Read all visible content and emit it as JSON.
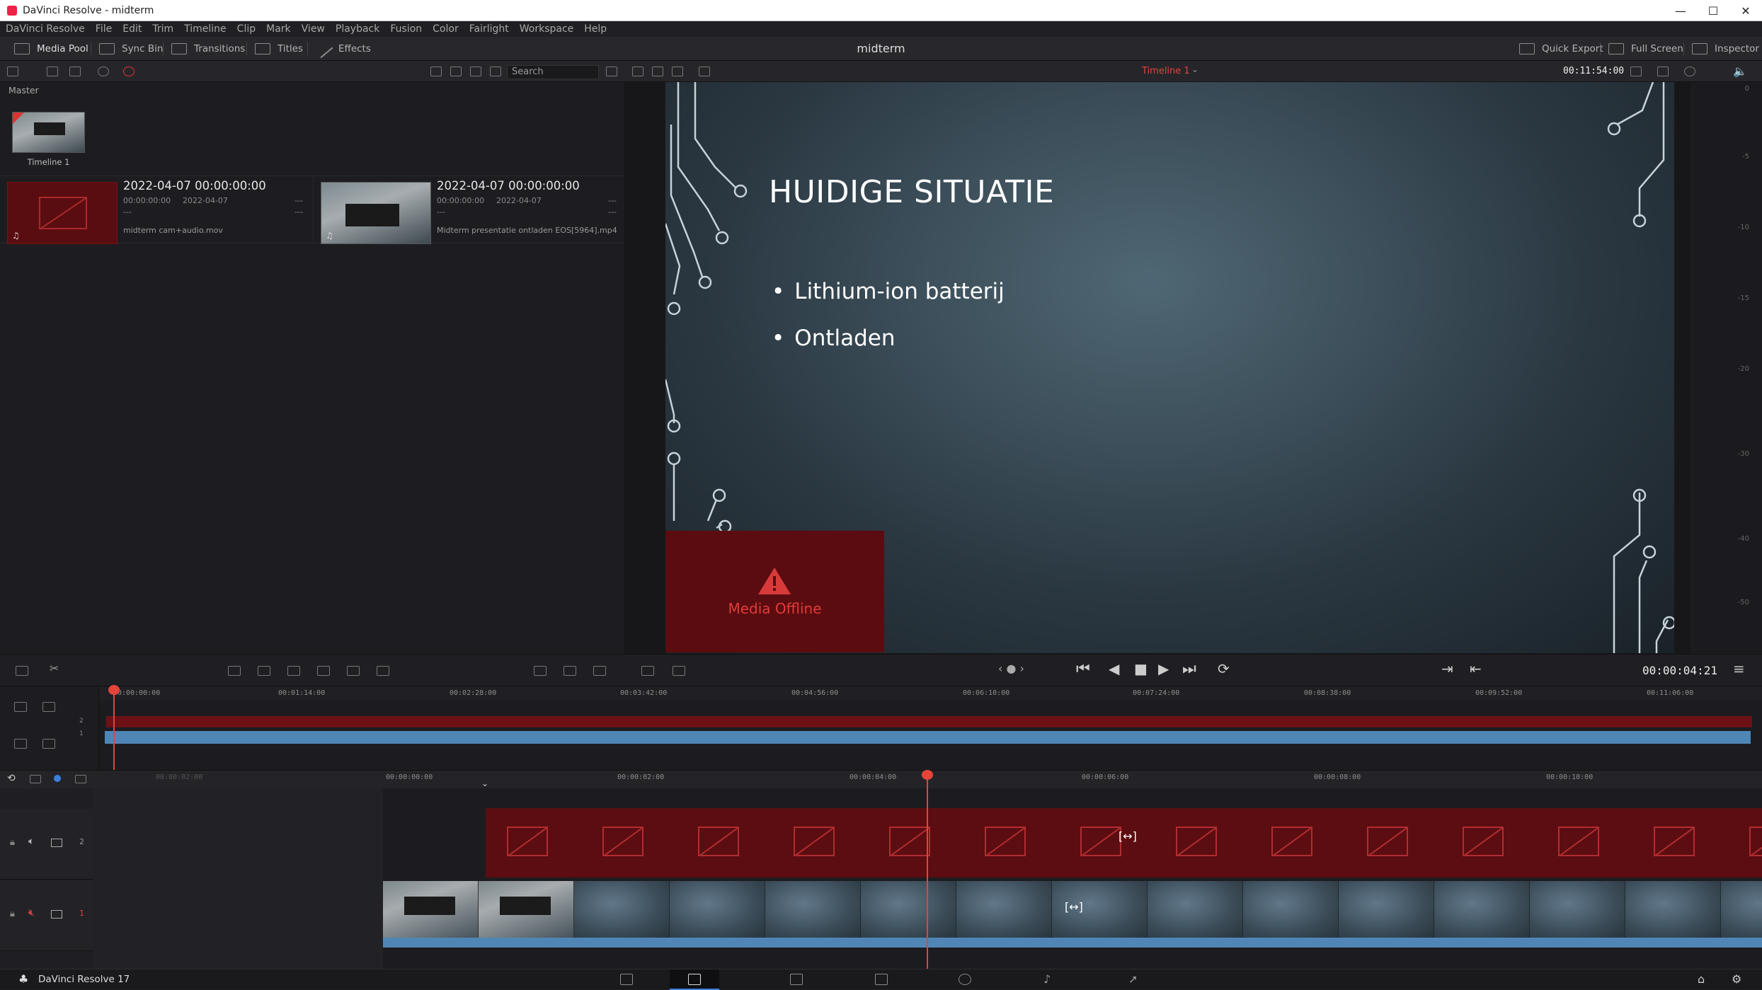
{
  "window": {
    "title": "DaVinci Resolve - midterm",
    "controls": [
      "—",
      "☐",
      "✕"
    ]
  },
  "menu": [
    "DaVinci Resolve",
    "File",
    "Edit",
    "Trim",
    "Timeline",
    "Clip",
    "Mark",
    "View",
    "Playback",
    "Fusion",
    "Color",
    "Fairlight",
    "Workspace",
    "Help"
  ],
  "toolbar": {
    "media_pool": "Media Pool",
    "sync_bin": "Sync Bin",
    "transitions": "Transitions",
    "titles": "Titles",
    "effects": "Effects",
    "project": "midterm",
    "quick_export": "Quick Export",
    "full_screen": "Full Screen",
    "inspector": "Inspector"
  },
  "pool": {
    "search_placeholder": "Search",
    "bin": "Master",
    "timeline_label": "Timeline 1",
    "clips": [
      {
        "date": "2022-04-07  00:00:00:00",
        "tc": "00:00:00:00",
        "date2": "2022-04-07",
        "dash1": "---",
        "dash2": "---",
        "dash3": "---",
        "name": "midterm cam+audio.mov"
      },
      {
        "date": "2022-04-07  00:00:00:00",
        "tc": "00:00:00:00",
        "date2": "2022-04-07",
        "dash1": "---",
        "dash2": "---",
        "dash3": "---",
        "name": "Midterm presentatie ontladen EOS[5964].mp4"
      }
    ]
  },
  "viewer": {
    "timeline_name": "Timeline 1",
    "duration": "00:11:54:00",
    "current_tc": "00:00:04:21",
    "slide_title": "HUIDIGE SITUATIE",
    "bullets": [
      "Lithium-ion batterij",
      "Ontladen"
    ],
    "offline": "Media Offline"
  },
  "meter_scale": [
    "0",
    "-5",
    "-10",
    "-15",
    "-20",
    "-30",
    "-40",
    "-50"
  ],
  "ruler_top": [
    "00:00:00:00",
    "00:01:14:00",
    "00:02:28:00",
    "00:03:42:00",
    "00:04:56:00",
    "00:06:10:00",
    "00:07:24:00",
    "00:08:38:00",
    "00:09:52:00",
    "00:11:06:00"
  ],
  "ruler_bottom": [
    "00:00:02:00",
    "00:00:00:00",
    "00:00:02:00",
    "00:00:04:00",
    "00:00:06:00",
    "00:00:08:00",
    "00:00:10:00"
  ],
  "tracks": {
    "v2": "2",
    "v1": "1",
    "mini_v2": "2",
    "mini_v1": "1"
  },
  "footer": {
    "app": "DaVinci Resolve 17"
  },
  "colors": {
    "accent_red": "#e4443a",
    "clip_blue": "#4f86b6",
    "offline_red": "#5c0d11"
  }
}
